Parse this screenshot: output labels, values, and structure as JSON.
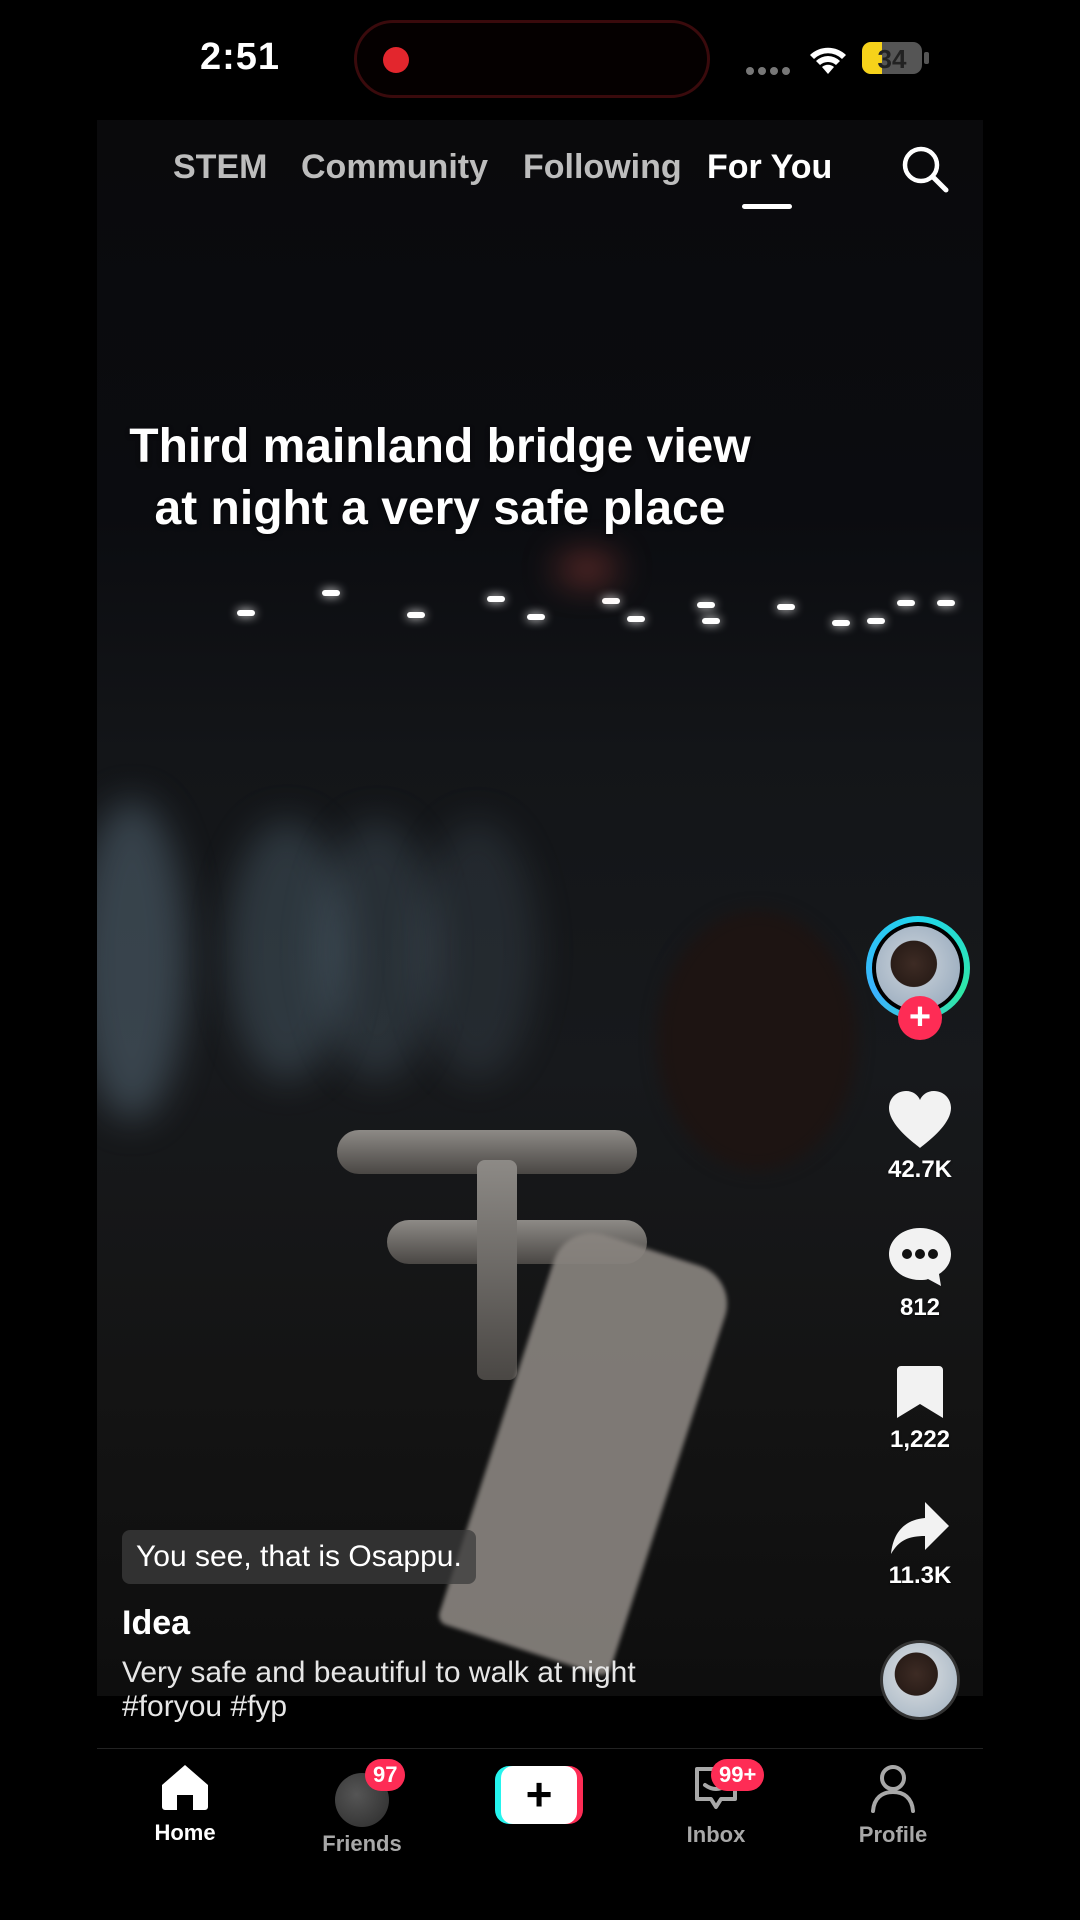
{
  "status_bar": {
    "time": "2:51",
    "battery": "34",
    "battery_level": 0.34
  },
  "top_nav": {
    "tabs": [
      {
        "label": "STEM"
      },
      {
        "label": "Community"
      },
      {
        "label": "Following"
      },
      {
        "label": "For You",
        "active": true
      }
    ],
    "search_icon": "search-icon"
  },
  "video": {
    "overlay_caption": "Third mainland bridge view at night a very safe place",
    "subtitle": "You see, that is Osappu."
  },
  "actions": {
    "like_count": "42.7K",
    "comment_count": "812",
    "bookmark_count": "1,222",
    "share_count": "11.3K",
    "follow_symbol": "+"
  },
  "post": {
    "author": "Idea",
    "description": "Very safe and beautiful to walk at night #foryou #fyp"
  },
  "bottom_nav": {
    "home": "Home",
    "friends": "Friends",
    "friends_badge": "97",
    "create_symbol": "+",
    "inbox": "Inbox",
    "inbox_badge": "99+",
    "profile": "Profile"
  },
  "colors": {
    "accent": "#fe2c55",
    "cyan": "#25f4ee",
    "battery": "#f6d21a"
  }
}
